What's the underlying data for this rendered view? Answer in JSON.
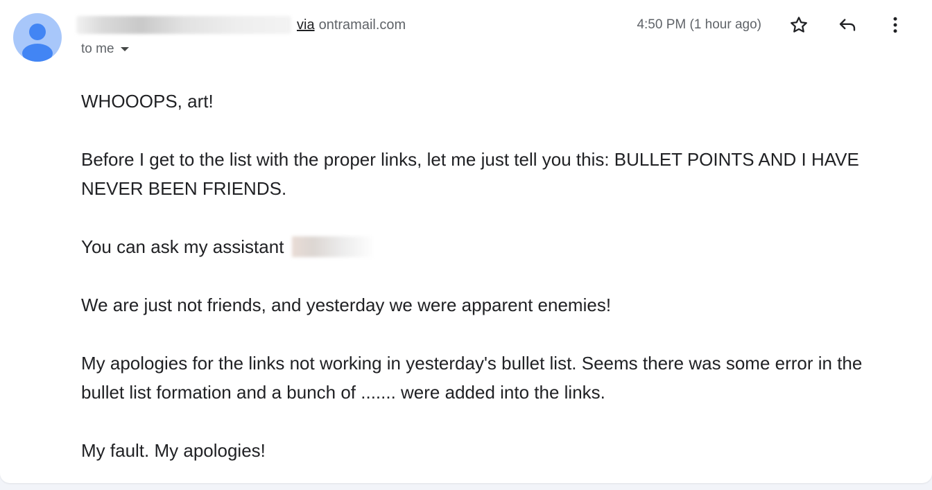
{
  "header": {
    "sender_via": "via",
    "sender_domain": "ontramail.com",
    "to_label": "to me",
    "timestamp": "4:50 PM (1 hour ago)"
  },
  "icons": {
    "avatar": "person-avatar-icon",
    "star": "star-icon",
    "reply": "reply-icon",
    "more": "more-vert-icon",
    "caret": "caret-down-icon"
  },
  "colors": {
    "avatar_bg": "#a8c7fa",
    "avatar_fg": "#4285f4",
    "text": "#202124",
    "muted": "#5f6368"
  },
  "message": {
    "greeting": "WHOOOPS, art!",
    "p1": "Before I get to the list with the proper links, let me just tell you this: BULLET POINTS AND I HAVE NEVER BEEN FRIENDS.",
    "p2": "You can ask my assistant",
    "p3": "We are just not friends, and yesterday we were apparent enemies!",
    "p4": "My apologies for the links not working in yesterday's bullet list. Seems there was some error in the bullet list formation and a bunch of ....... were added into the links.",
    "p5": "My fault. My apologies!"
  }
}
